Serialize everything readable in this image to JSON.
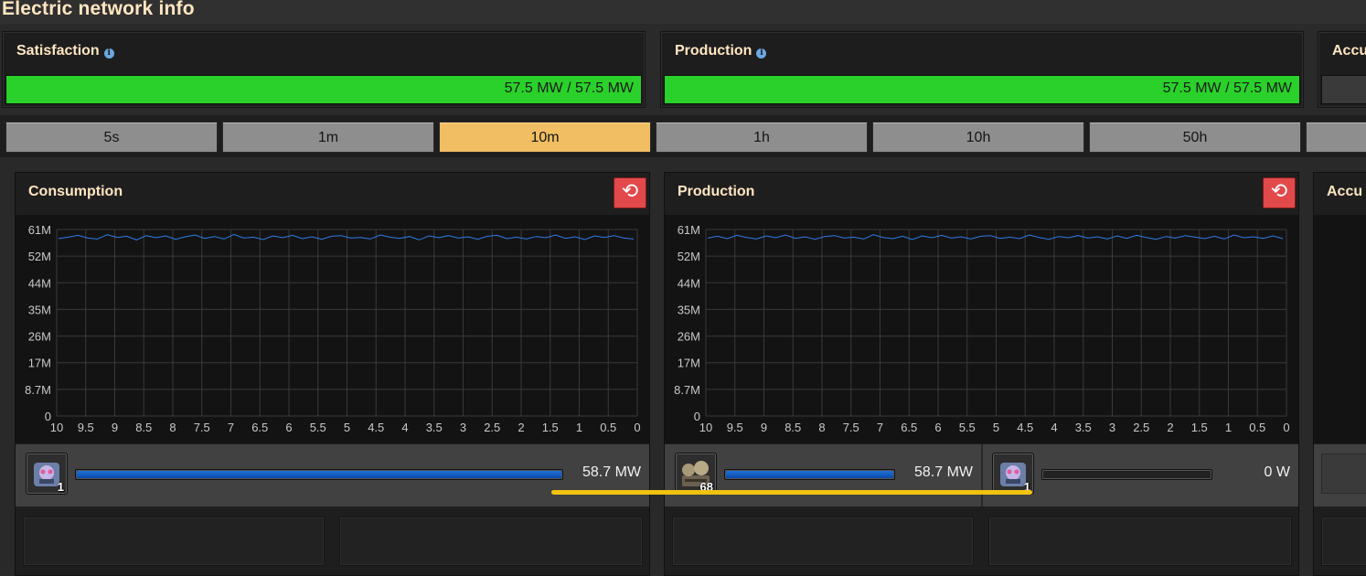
{
  "window": {
    "title": "Electric network info"
  },
  "summary": {
    "satisfaction": {
      "label": "Satisfaction",
      "value": "57.5 MW / 57.5 MW",
      "fill": 1.0
    },
    "production": {
      "label": "Production",
      "value": "57.5 MW / 57.5 MW",
      "fill": 1.0
    },
    "accumulator": {
      "label": "Accu"
    }
  },
  "time_tabs": [
    {
      "label": "5s",
      "active": false
    },
    {
      "label": "1m",
      "active": false
    },
    {
      "label": "10m",
      "active": true
    },
    {
      "label": "1h",
      "active": false
    },
    {
      "label": "10h",
      "active": false
    },
    {
      "label": "50h",
      "active": false
    }
  ],
  "panels": {
    "consumption": {
      "title": "Consumption",
      "entries": [
        {
          "icon": "assembling-machine-icon",
          "count": "1",
          "value": "58.7 MW",
          "fill": 1.0
        }
      ]
    },
    "production": {
      "title": "Production",
      "entries": [
        {
          "icon": "steam-engine-icon",
          "count": "68",
          "value": "58.7 MW",
          "fill": 1.0
        },
        {
          "icon": "assembling-machine-icon",
          "count": "1",
          "value": "0 W",
          "fill": 0.0
        }
      ]
    },
    "accumulator": {
      "title": "Accu"
    }
  },
  "colors": {
    "bar_green": "#2ad12a",
    "tab_active": "#f1be64",
    "series_line": "#2e7be8",
    "reset_button": "#e2494b",
    "highlight_line": "#f2c30f"
  },
  "chart_data": [
    {
      "type": "line",
      "title": "Consumption",
      "xlabel": "",
      "ylabel": "",
      "x_ticks": [
        "10",
        "9.5",
        "9",
        "8.5",
        "8",
        "7.5",
        "7",
        "6.5",
        "6",
        "5.5",
        "5",
        "4.5",
        "4",
        "3.5",
        "3",
        "2.5",
        "2",
        "1.5",
        "1",
        "0.5",
        "0"
      ],
      "y_ticks": [
        "0",
        "8.7M",
        "17M",
        "26M",
        "35M",
        "44M",
        "52M",
        "61M"
      ],
      "xlim": [
        10,
        0
      ],
      "ylim": [
        0,
        61
      ],
      "grid": true,
      "series": [
        {
          "values": [
            58.0,
            58.5,
            59.1,
            58.2,
            57.9,
            59.3,
            58.4,
            58.8,
            57.6,
            59.0,
            58.3,
            58.9,
            57.8,
            58.6,
            59.2,
            58.1,
            58.7,
            57.9,
            59.4,
            58.2,
            58.5,
            57.7,
            58.9,
            58.3,
            59.1,
            58.0,
            58.6,
            57.8,
            58.8,
            59.0,
            58.2,
            58.4,
            57.9,
            59.2,
            58.5,
            58.1,
            58.7,
            57.6,
            58.9,
            58.3,
            59.0,
            58.2,
            58.6,
            57.8,
            58.8,
            59.1,
            58.0,
            58.5,
            57.9,
            58.7,
            58.3,
            59.2,
            58.1,
            58.6,
            57.7,
            58.9,
            58.4,
            59.0,
            58.2,
            57.9
          ]
        }
      ]
    },
    {
      "type": "line",
      "title": "Production",
      "xlabel": "",
      "ylabel": "",
      "x_ticks": [
        "10",
        "9.5",
        "9",
        "8.5",
        "8",
        "7.5",
        "7",
        "6.5",
        "6",
        "5.5",
        "5",
        "4.5",
        "4",
        "3.5",
        "3",
        "2.5",
        "2",
        "1.5",
        "1",
        "0.5",
        "0"
      ],
      "y_ticks": [
        "0",
        "8.7M",
        "17M",
        "26M",
        "35M",
        "44M",
        "52M",
        "61M"
      ],
      "xlim": [
        10,
        0
      ],
      "ylim": [
        0,
        61
      ],
      "grid": true,
      "series": [
        {
          "values": [
            58.2,
            58.8,
            58.0,
            59.1,
            58.4,
            57.9,
            58.9,
            58.3,
            59.2,
            58.1,
            58.6,
            57.8,
            58.7,
            59.0,
            58.2,
            58.5,
            57.9,
            59.3,
            58.4,
            58.0,
            58.8,
            57.7,
            58.9,
            58.3,
            59.1,
            58.2,
            58.6,
            57.9,
            58.8,
            59.0,
            58.1,
            58.5,
            58.0,
            59.2,
            58.4,
            57.8,
            58.7,
            58.3,
            59.0,
            58.2,
            58.6,
            57.9,
            58.9,
            58.1,
            59.1,
            58.4,
            57.8,
            58.7,
            58.2,
            59.0,
            58.5,
            58.0,
            58.8,
            57.9,
            59.2,
            58.3,
            58.6,
            58.1,
            58.9,
            58.0
          ]
        }
      ]
    }
  ]
}
